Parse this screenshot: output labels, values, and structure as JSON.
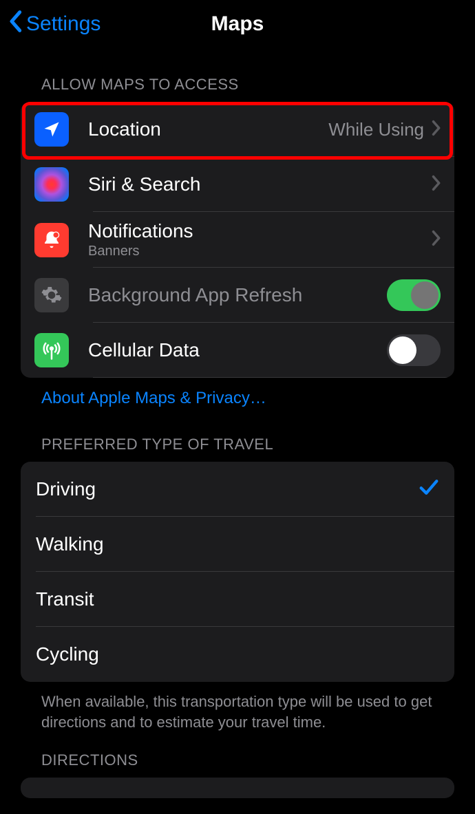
{
  "nav": {
    "back": "Settings",
    "title": "Maps"
  },
  "access": {
    "header": "ALLOW MAPS TO ACCESS",
    "location": {
      "label": "Location",
      "value": "While Using"
    },
    "siri": {
      "label": "Siri & Search"
    },
    "notifications": {
      "label": "Notifications",
      "sub": "Banners"
    },
    "refresh": {
      "label": "Background App Refresh",
      "on": true
    },
    "cellular": {
      "label": "Cellular Data",
      "on": false
    }
  },
  "privacy_link": "About Apple Maps & Privacy…",
  "travel": {
    "header": "PREFERRED TYPE OF TRAVEL",
    "options": [
      "Driving",
      "Walking",
      "Transit",
      "Cycling"
    ],
    "selected": "Driving",
    "footer": "When available, this transportation type will be used to get directions and to estimate your travel time."
  },
  "directions_header": "DIRECTIONS"
}
